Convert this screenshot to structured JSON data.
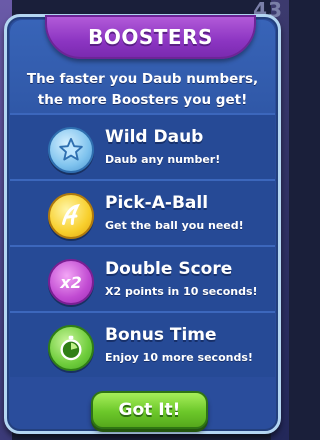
{
  "background": {
    "corner_number": "43"
  },
  "dialog": {
    "title": "BOOSTERS",
    "subtitle_line1": "The faster you Daub numbers,",
    "subtitle_line2": "the more Boosters you get!",
    "boosters": [
      {
        "name": "Wild Daub",
        "description": "Daub any number!",
        "icon": "star-icon",
        "color": "#7fc3ee"
      },
      {
        "name": "Pick-A-Ball",
        "description": "Get the ball you need!",
        "icon": "ball-icon",
        "color": "#f8cf2c"
      },
      {
        "name": "Double Score",
        "description": "X2 points in 10 seconds!",
        "icon": "x2-icon",
        "icon_text": "x2",
        "color": "#c14bd2"
      },
      {
        "name": "Bonus Time",
        "description": "Enjoy 10 more seconds!",
        "icon": "stopwatch-icon",
        "color": "#6fcd3c"
      }
    ],
    "button_label": "Got It!"
  }
}
